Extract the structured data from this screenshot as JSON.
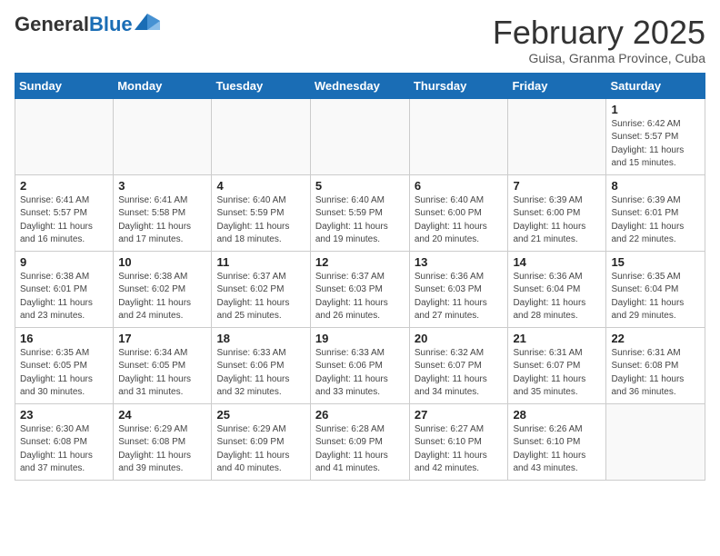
{
  "header": {
    "logo_general": "General",
    "logo_blue": "Blue",
    "month_title": "February 2025",
    "subtitle": "Guisa, Granma Province, Cuba"
  },
  "weekdays": [
    "Sunday",
    "Monday",
    "Tuesday",
    "Wednesday",
    "Thursday",
    "Friday",
    "Saturday"
  ],
  "weeks": [
    [
      {
        "day": "",
        "info": ""
      },
      {
        "day": "",
        "info": ""
      },
      {
        "day": "",
        "info": ""
      },
      {
        "day": "",
        "info": ""
      },
      {
        "day": "",
        "info": ""
      },
      {
        "day": "",
        "info": ""
      },
      {
        "day": "1",
        "info": "Sunrise: 6:42 AM\nSunset: 5:57 PM\nDaylight: 11 hours and 15 minutes."
      }
    ],
    [
      {
        "day": "2",
        "info": "Sunrise: 6:41 AM\nSunset: 5:57 PM\nDaylight: 11 hours and 16 minutes."
      },
      {
        "day": "3",
        "info": "Sunrise: 6:41 AM\nSunset: 5:58 PM\nDaylight: 11 hours and 17 minutes."
      },
      {
        "day": "4",
        "info": "Sunrise: 6:40 AM\nSunset: 5:59 PM\nDaylight: 11 hours and 18 minutes."
      },
      {
        "day": "5",
        "info": "Sunrise: 6:40 AM\nSunset: 5:59 PM\nDaylight: 11 hours and 19 minutes."
      },
      {
        "day": "6",
        "info": "Sunrise: 6:40 AM\nSunset: 6:00 PM\nDaylight: 11 hours and 20 minutes."
      },
      {
        "day": "7",
        "info": "Sunrise: 6:39 AM\nSunset: 6:00 PM\nDaylight: 11 hours and 21 minutes."
      },
      {
        "day": "8",
        "info": "Sunrise: 6:39 AM\nSunset: 6:01 PM\nDaylight: 11 hours and 22 minutes."
      }
    ],
    [
      {
        "day": "9",
        "info": "Sunrise: 6:38 AM\nSunset: 6:01 PM\nDaylight: 11 hours and 23 minutes."
      },
      {
        "day": "10",
        "info": "Sunrise: 6:38 AM\nSunset: 6:02 PM\nDaylight: 11 hours and 24 minutes."
      },
      {
        "day": "11",
        "info": "Sunrise: 6:37 AM\nSunset: 6:02 PM\nDaylight: 11 hours and 25 minutes."
      },
      {
        "day": "12",
        "info": "Sunrise: 6:37 AM\nSunset: 6:03 PM\nDaylight: 11 hours and 26 minutes."
      },
      {
        "day": "13",
        "info": "Sunrise: 6:36 AM\nSunset: 6:03 PM\nDaylight: 11 hours and 27 minutes."
      },
      {
        "day": "14",
        "info": "Sunrise: 6:36 AM\nSunset: 6:04 PM\nDaylight: 11 hours and 28 minutes."
      },
      {
        "day": "15",
        "info": "Sunrise: 6:35 AM\nSunset: 6:04 PM\nDaylight: 11 hours and 29 minutes."
      }
    ],
    [
      {
        "day": "16",
        "info": "Sunrise: 6:35 AM\nSunset: 6:05 PM\nDaylight: 11 hours and 30 minutes."
      },
      {
        "day": "17",
        "info": "Sunrise: 6:34 AM\nSunset: 6:05 PM\nDaylight: 11 hours and 31 minutes."
      },
      {
        "day": "18",
        "info": "Sunrise: 6:33 AM\nSunset: 6:06 PM\nDaylight: 11 hours and 32 minutes."
      },
      {
        "day": "19",
        "info": "Sunrise: 6:33 AM\nSunset: 6:06 PM\nDaylight: 11 hours and 33 minutes."
      },
      {
        "day": "20",
        "info": "Sunrise: 6:32 AM\nSunset: 6:07 PM\nDaylight: 11 hours and 34 minutes."
      },
      {
        "day": "21",
        "info": "Sunrise: 6:31 AM\nSunset: 6:07 PM\nDaylight: 11 hours and 35 minutes."
      },
      {
        "day": "22",
        "info": "Sunrise: 6:31 AM\nSunset: 6:08 PM\nDaylight: 11 hours and 36 minutes."
      }
    ],
    [
      {
        "day": "23",
        "info": "Sunrise: 6:30 AM\nSunset: 6:08 PM\nDaylight: 11 hours and 37 minutes."
      },
      {
        "day": "24",
        "info": "Sunrise: 6:29 AM\nSunset: 6:08 PM\nDaylight: 11 hours and 39 minutes."
      },
      {
        "day": "25",
        "info": "Sunrise: 6:29 AM\nSunset: 6:09 PM\nDaylight: 11 hours and 40 minutes."
      },
      {
        "day": "26",
        "info": "Sunrise: 6:28 AM\nSunset: 6:09 PM\nDaylight: 11 hours and 41 minutes."
      },
      {
        "day": "27",
        "info": "Sunrise: 6:27 AM\nSunset: 6:10 PM\nDaylight: 11 hours and 42 minutes."
      },
      {
        "day": "28",
        "info": "Sunrise: 6:26 AM\nSunset: 6:10 PM\nDaylight: 11 hours and 43 minutes."
      },
      {
        "day": "",
        "info": ""
      }
    ]
  ]
}
